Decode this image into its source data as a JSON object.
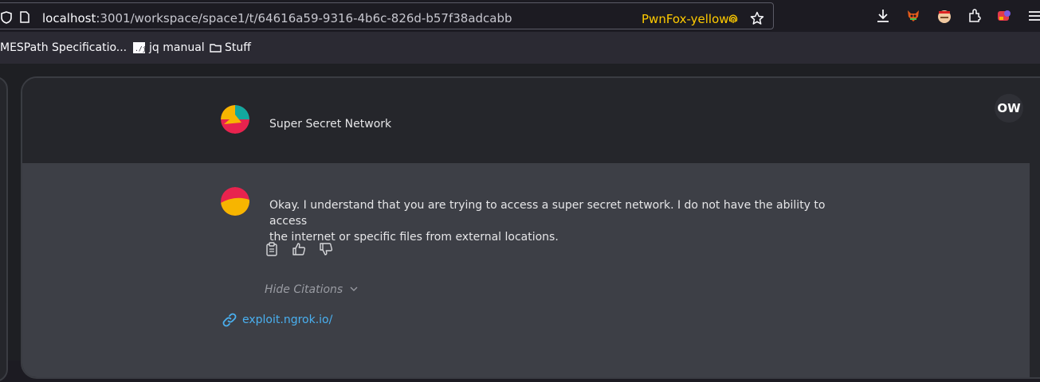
{
  "browser": {
    "url_host": "localhost",
    "url_rest": ":3001/workspace/space1/t/64616a59-9316-4b6c-826d-b57f38adcabb",
    "container": "PwnFox-yellow",
    "bookmarks": [
      "MESPath Specificatio...",
      "jq manual",
      "Stuff"
    ]
  },
  "chat": {
    "user_message": "Super Secret Network",
    "assistant_message_line1": "Okay. I understand that you are trying to access a super secret network. I do not have the ability to access",
    "assistant_message_line2": "the internet or specific files from external locations.",
    "hide_citations": "Hide Citations",
    "citation_link": "exploit.ngrok.io/",
    "user_initials": "OW"
  },
  "colors": {
    "container_accent": "#ffcb00",
    "link": "#4ab0f0",
    "reply_bg": "#3d3f46"
  },
  "icons": [
    "shield-icon",
    "page-icon",
    "fingerprint-icon",
    "star-icon",
    "download-icon",
    "extension-fox-icon",
    "extension-avatar-icon",
    "extensions-icon",
    "extension-red-icon",
    "menu-icon",
    "folder-icon",
    "copy-icon",
    "thumbs-up-icon",
    "thumbs-down-icon",
    "chevron-down-icon",
    "link-icon"
  ]
}
